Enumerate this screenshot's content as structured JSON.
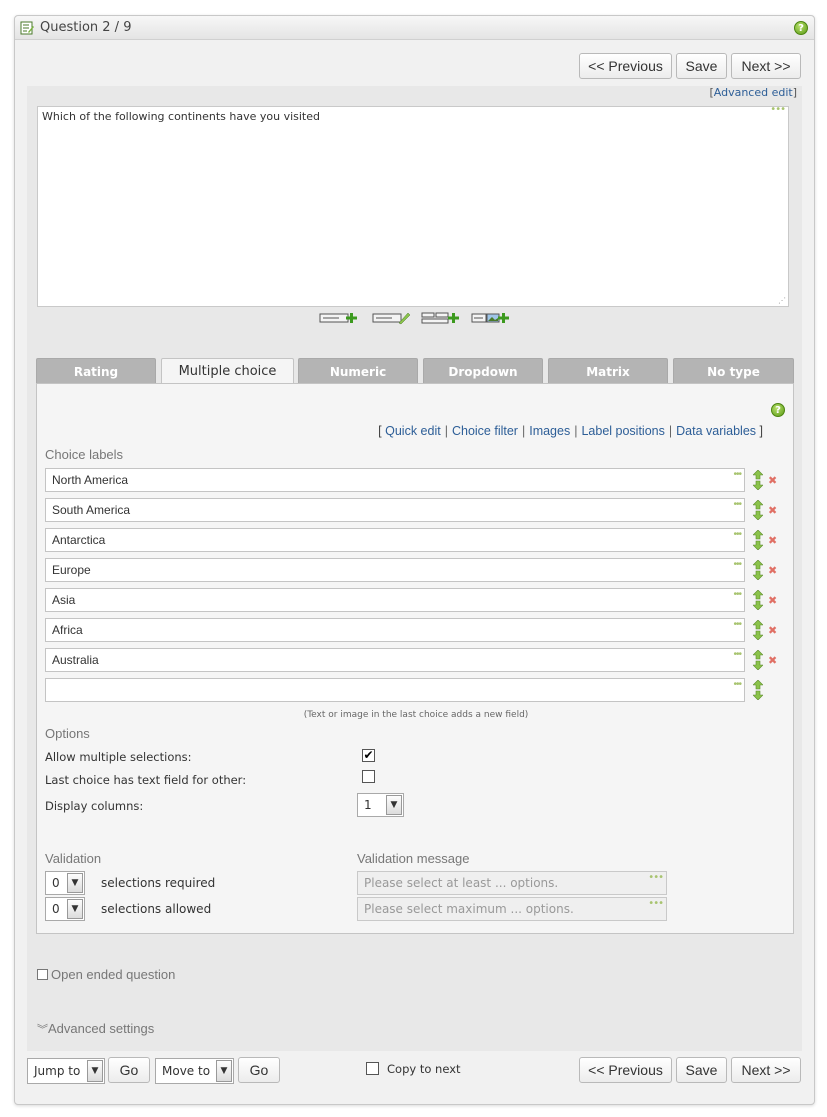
{
  "header": {
    "title": "Question 2 / 9",
    "help_icon": "?"
  },
  "nav": {
    "previous_label": "<< Previous",
    "save_label": "Save",
    "next_label": "Next >>"
  },
  "editor": {
    "advanced_edit_open": "[",
    "advanced_edit_label": "Advanced edit",
    "advanced_edit_close": "]",
    "question_text": "Which of the following continents have you visited",
    "toolbar_icons": [
      "add-field-icon",
      "edit-field-icon",
      "add-list-icon",
      "add-image-icon"
    ]
  },
  "tabs": [
    {
      "label": "Rating",
      "active": false
    },
    {
      "label": "Multiple choice",
      "active": true
    },
    {
      "label": "Numeric",
      "active": false
    },
    {
      "label": "Dropdown",
      "active": false
    },
    {
      "label": "Matrix",
      "active": false
    },
    {
      "label": "No type",
      "active": false
    }
  ],
  "sublinks": {
    "open": "[",
    "close": "]",
    "items": [
      "Quick edit",
      "Choice filter",
      "Images",
      "Label positions",
      "Data variables"
    ]
  },
  "choices": {
    "heading": "Choice labels",
    "items": [
      "North America",
      "South America",
      "Antarctica",
      "Europe",
      "Asia",
      "Africa",
      "Australia",
      ""
    ],
    "hint": "(Text or image in the last choice adds a new field)"
  },
  "options": {
    "heading": "Options",
    "allow_multiple_label": "Allow multiple selections:",
    "allow_multiple_checked": true,
    "other_text_label": "Last choice has text field for other:",
    "other_text_checked": false,
    "display_columns_label": "Display columns:",
    "display_columns_value": "1"
  },
  "validation": {
    "heading": "Validation",
    "message_heading": "Validation message",
    "required_value": "0",
    "required_label": "selections required",
    "allowed_value": "0",
    "allowed_label": "selections allowed",
    "min_placeholder": "Please select at least ... options.",
    "max_placeholder": "Please select maximum ... options."
  },
  "sections": {
    "open_ended_label": "Open ended question",
    "advanced_label": "Advanced settings"
  },
  "footer": {
    "jump_to_label": "Jump to",
    "go_label": "Go",
    "move_to_label": "Move to",
    "go2_label": "Go",
    "copy_to_next_label": "Copy to next"
  },
  "colors": {
    "link": "#2d5e97",
    "tab_inactive": "#b4b4b4",
    "help_green": "#5a9a15",
    "delete_red": "#e07065"
  }
}
